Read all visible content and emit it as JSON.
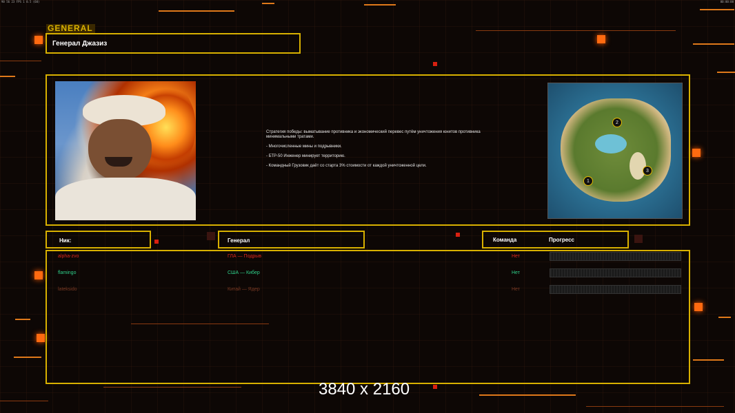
{
  "window": {
    "status_left": "90 56 23 FPS 1 0.5 (60)",
    "status_right": "00:00:00"
  },
  "header": {
    "tag": "GENERAL",
    "title": "Генерал Джазиз"
  },
  "general": {
    "portrait_icon": "general-portrait",
    "description": [
      "Стратегия победы: выматывание противника и экономический перевес путём уничтожения юнитов противника минимальными тратами.",
      "- Многочисленные мины и подрывники.",
      "- БТР-50 Инженер минирует территорию.",
      "- Командный Грузовик даёт со старта 3% стоимости от каждой уничтоженной цели."
    ]
  },
  "map": {
    "spawns": [
      "1",
      "2",
      "3"
    ]
  },
  "table": {
    "headers": {
      "nick": "Ник:",
      "general": "Генерал",
      "team": "Команда",
      "progress": "Прогресс"
    },
    "rows": [
      {
        "nick": "alpha-zvo",
        "general": "ГЛА — Подрыв",
        "team": "Нет",
        "color": "#e0281c",
        "progress": 0
      },
      {
        "nick": "flamingo",
        "general": "США — Кибер",
        "team": "Нет",
        "color": "#2fd08a",
        "progress": 0
      },
      {
        "nick": "lateksido",
        "general": "Китай — Ядер",
        "team": "Нет",
        "color": "#7a3a24",
        "progress": 0
      }
    ]
  },
  "footer": {
    "resolution": "3840 x 2160"
  },
  "colors": {
    "accent": "#d9b100",
    "background": "#0d0705",
    "glow": "#ff6a10"
  }
}
